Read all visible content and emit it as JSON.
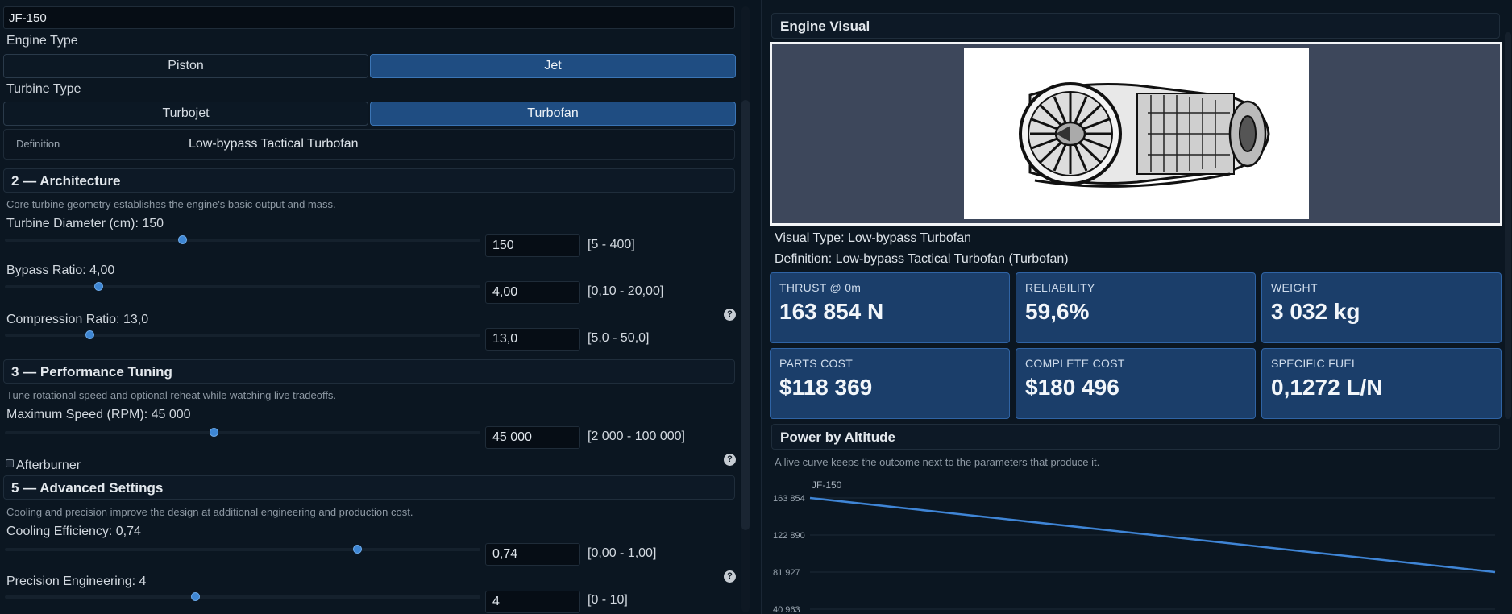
{
  "left": {
    "name_value": "JF-150",
    "engine_type": {
      "label": "Engine Type",
      "options": [
        "Piston",
        "Jet"
      ],
      "selected": "Jet"
    },
    "turbine_type": {
      "label": "Turbine Type",
      "options": [
        "Turbojet",
        "Turbofan"
      ],
      "selected": "Turbofan"
    },
    "definition": {
      "label": "Definition",
      "value": "Low-bypass Tactical Turbofan"
    },
    "architecture": {
      "title": "2 — Architecture",
      "hint": "Core turbine geometry establishes the engine's basic output and mass.",
      "turbine_diameter": {
        "label": "Turbine Diameter (cm): 150",
        "value": "150",
        "range": "[5 - 400]",
        "fraction": 0.373
      },
      "bypass_ratio": {
        "label": "Bypass Ratio: 4,00",
        "value": "4,00",
        "range": "[0,10 - 20,00]",
        "fraction": 0.196
      },
      "compression_ratio": {
        "label": "Compression Ratio: 13,0",
        "value": "13,0",
        "range": "[5,0 - 50,0]",
        "fraction": 0.178
      },
      "help": "?"
    },
    "performance": {
      "title": "3 — Performance Tuning",
      "hint": "Tune rotational speed and optional reheat while watching live tradeoffs.",
      "max_speed": {
        "label": "Maximum Speed (RPM): 45 000",
        "value": "45 000",
        "range": "[2 000 - 100 000]",
        "fraction": 0.439
      },
      "afterburner": {
        "label": "Afterburner",
        "checked": false
      },
      "help": "?"
    },
    "advanced": {
      "title": "5 — Advanced Settings",
      "hint": "Cooling and precision improve the design at additional engineering and production cost.",
      "cooling": {
        "label": "Cooling Efficiency: 0,74",
        "value": "0,74",
        "range": "[0,00 - 1,00]",
        "fraction": 0.74
      },
      "precision": {
        "label": "Precision Engineering: 4",
        "value": "4",
        "range": "[0 - 10]",
        "fraction": 0.4
      },
      "help": "?"
    }
  },
  "right": {
    "visual_title": "Engine Visual",
    "visual_type": "Visual Type: Low-bypass Turbofan",
    "visual_definition": "Definition: Low-bypass Tactical Turbofan (Turbofan)",
    "cards": [
      {
        "key": "THRUST @ 0m",
        "value": "163 854 N"
      },
      {
        "key": "RELIABILITY",
        "value": "59,6%"
      },
      {
        "key": "WEIGHT",
        "value": "3 032 kg"
      },
      {
        "key": "PARTS COST",
        "value": "$118 369"
      },
      {
        "key": "COMPLETE COST",
        "value": "$180 496"
      },
      {
        "key": "SPECIFIC FUEL",
        "value": "0,1272 L/N"
      }
    ],
    "power_title": "Power by Altitude",
    "power_hint": "A live curve keeps the outcome next to the parameters that produce it."
  },
  "chart_data": {
    "type": "line",
    "title": "",
    "xlabel": "",
    "ylabel": "",
    "series": [
      {
        "name": "JF-150",
        "x": [
          0,
          1
        ],
        "values": [
          163854,
          81927
        ]
      }
    ],
    "yticks": [
      "163 854",
      "122 890",
      "81 927",
      "40 963"
    ],
    "ylim": [
      40963,
      163854
    ],
    "grid": true,
    "color": "#3f85d6"
  }
}
